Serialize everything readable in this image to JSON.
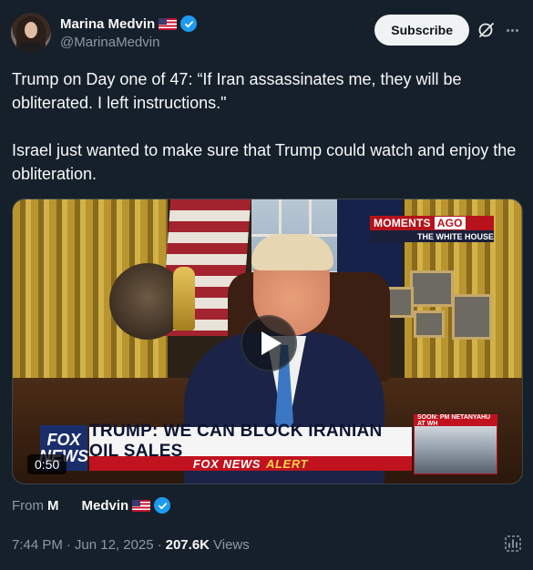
{
  "header": {
    "display_name": "Marina Medvin",
    "handle": "@MarinaMedvin",
    "subscribe_label": "Subscribe"
  },
  "tweet": {
    "text": "Trump on Day one of 47: “If Iran assassinates me, they will be obliterated. I left instructions.\"\n\nIsrael just wanted to make sure that Trump could watch and enjoy the obliteration."
  },
  "video": {
    "duration": "0:50",
    "overlay": {
      "moments_label": "MOMENTS",
      "ago_label": "AGO",
      "location_label": "THE WHITE HOUSE",
      "channel_logo_line1": "FOX",
      "channel_logo_line2": "NEWS",
      "headline": "TRUMP: WE CAN BLOCK IRANIAN OIL SALES",
      "alert_brand": "FOX NEWS",
      "alert_word": "ALERT",
      "soon_label": "SOON: PM NETANYAHU AT WH"
    }
  },
  "attribution": {
    "from_label": "From",
    "source_name": "M      Medvin"
  },
  "meta": {
    "time": "7:44 PM",
    "separator": "·",
    "date": "Jun 12, 2025",
    "views_count": "207.6K",
    "views_label": "Views"
  },
  "colors": {
    "background": "#15202b",
    "verified": "#1d9bf0",
    "muted_text": "#8b98a5"
  },
  "icons": {
    "verified": "verified-badge-icon",
    "grok": "grok-icon",
    "more": "more-icon",
    "play": "play-icon",
    "analytics": "analytics-icon",
    "flag": "us-flag-icon"
  }
}
